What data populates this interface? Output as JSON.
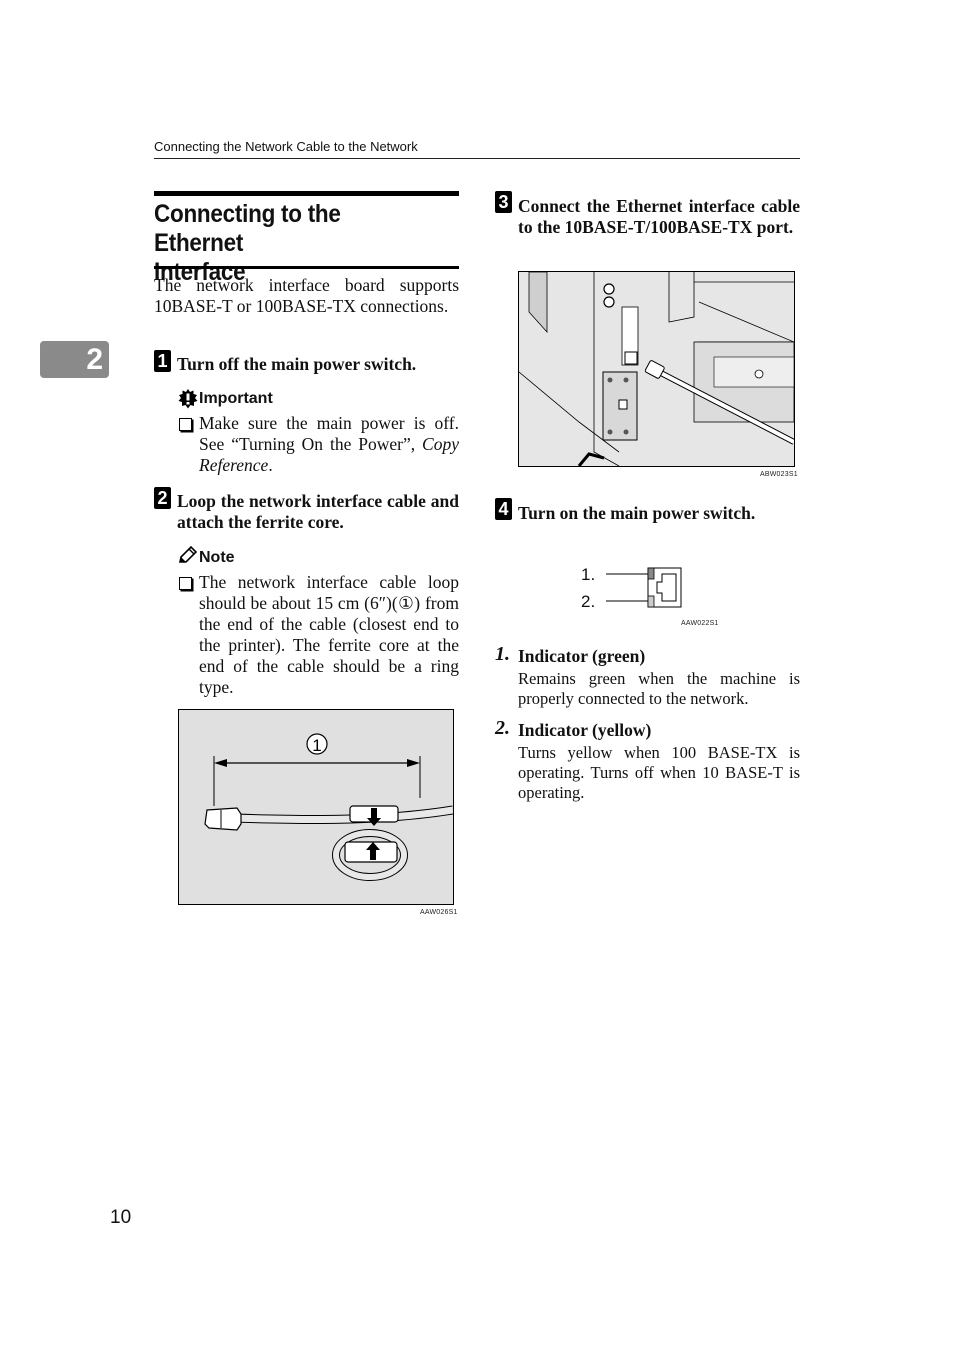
{
  "running_head": "Connecting the Network Cable to the Network",
  "chapter_tab": "2",
  "section_title_line1": "Connecting to the Ethernet",
  "section_title_line2": "Interface",
  "intro": "The network interface board supports 10BASE-T or 100BASE-TX connections.",
  "steps": [
    {
      "number": "1",
      "text": "Turn off the main power switch.",
      "callout": {
        "type": "Important",
        "icon": "important-icon",
        "bullet_pre": "Make sure the main power is off. See “Turning On the Power”, ",
        "bullet_ref": "Copy Reference",
        "bullet_post": "."
      }
    },
    {
      "number": "2",
      "text": "Loop the network interface cable and attach the ferrite core.",
      "callout": {
        "type": "Note",
        "icon": "pencil-icon",
        "bullet": "The network interface cable loop should be about 15 cm (6″)(①) from the end of the cable (closest end to the printer). The ferrite core at the end of the cable should be a ring type."
      },
      "figure": {
        "callout_marker": "1",
        "code": "AAW026S1"
      }
    },
    {
      "number": "3",
      "text": "Connect the Ethernet interface cable to the 10BASE-T/100BASE-TX port.",
      "figure": {
        "code": "ABW023S1"
      }
    },
    {
      "number": "4",
      "text": "Turn on the main power switch.",
      "figure": {
        "labels": [
          "1.",
          "2."
        ],
        "code": "AAW022S1"
      }
    }
  ],
  "indicators": [
    {
      "number": "1.",
      "title": "Indicator (green)",
      "description": "Remains green when the machine is properly connected to the network."
    },
    {
      "number": "2.",
      "title": "Indicator (yellow)",
      "description": "Turns yellow when 100 BASE-TX is operating. Turns off when 10 BASE-T is operating."
    }
  ],
  "page_number": "10"
}
